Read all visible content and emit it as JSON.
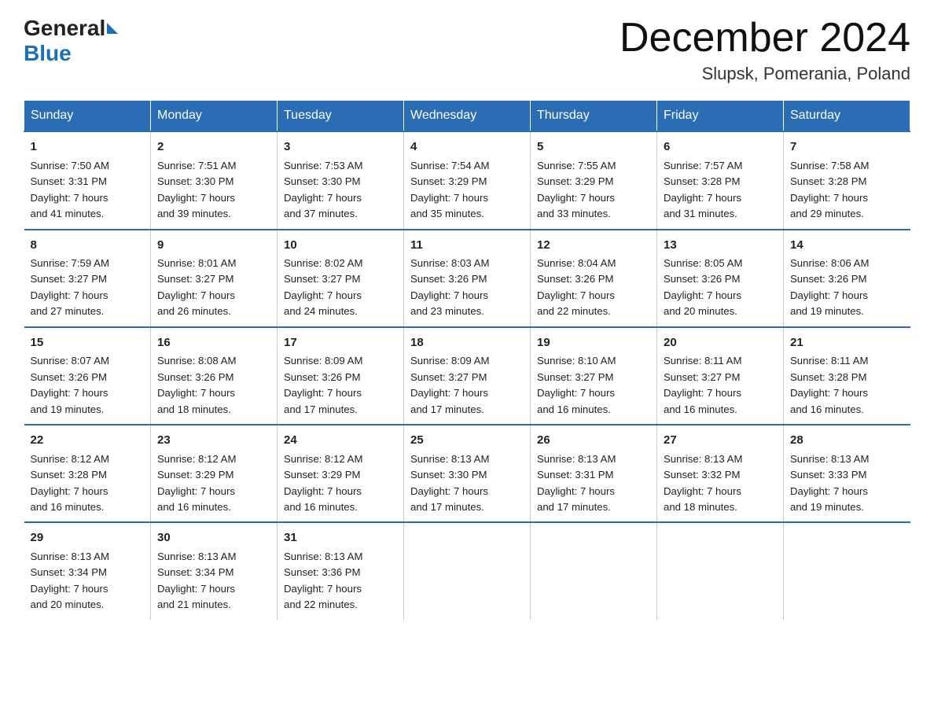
{
  "header": {
    "logo_general": "General",
    "logo_blue": "Blue",
    "month_title": "December 2024",
    "location": "Slupsk, Pomerania, Poland"
  },
  "days_of_week": [
    "Sunday",
    "Monday",
    "Tuesday",
    "Wednesday",
    "Thursday",
    "Friday",
    "Saturday"
  ],
  "weeks": [
    [
      {
        "day": "1",
        "sunrise": "7:50 AM",
        "sunset": "3:31 PM",
        "daylight": "7 hours and 41 minutes."
      },
      {
        "day": "2",
        "sunrise": "7:51 AM",
        "sunset": "3:30 PM",
        "daylight": "7 hours and 39 minutes."
      },
      {
        "day": "3",
        "sunrise": "7:53 AM",
        "sunset": "3:30 PM",
        "daylight": "7 hours and 37 minutes."
      },
      {
        "day": "4",
        "sunrise": "7:54 AM",
        "sunset": "3:29 PM",
        "daylight": "7 hours and 35 minutes."
      },
      {
        "day": "5",
        "sunrise": "7:55 AM",
        "sunset": "3:29 PM",
        "daylight": "7 hours and 33 minutes."
      },
      {
        "day": "6",
        "sunrise": "7:57 AM",
        "sunset": "3:28 PM",
        "daylight": "7 hours and 31 minutes."
      },
      {
        "day": "7",
        "sunrise": "7:58 AM",
        "sunset": "3:28 PM",
        "daylight": "7 hours and 29 minutes."
      }
    ],
    [
      {
        "day": "8",
        "sunrise": "7:59 AM",
        "sunset": "3:27 PM",
        "daylight": "7 hours and 27 minutes."
      },
      {
        "day": "9",
        "sunrise": "8:01 AM",
        "sunset": "3:27 PM",
        "daylight": "7 hours and 26 minutes."
      },
      {
        "day": "10",
        "sunrise": "8:02 AM",
        "sunset": "3:27 PM",
        "daylight": "7 hours and 24 minutes."
      },
      {
        "day": "11",
        "sunrise": "8:03 AM",
        "sunset": "3:26 PM",
        "daylight": "7 hours and 23 minutes."
      },
      {
        "day": "12",
        "sunrise": "8:04 AM",
        "sunset": "3:26 PM",
        "daylight": "7 hours and 22 minutes."
      },
      {
        "day": "13",
        "sunrise": "8:05 AM",
        "sunset": "3:26 PM",
        "daylight": "7 hours and 20 minutes."
      },
      {
        "day": "14",
        "sunrise": "8:06 AM",
        "sunset": "3:26 PM",
        "daylight": "7 hours and 19 minutes."
      }
    ],
    [
      {
        "day": "15",
        "sunrise": "8:07 AM",
        "sunset": "3:26 PM",
        "daylight": "7 hours and 19 minutes."
      },
      {
        "day": "16",
        "sunrise": "8:08 AM",
        "sunset": "3:26 PM",
        "daylight": "7 hours and 18 minutes."
      },
      {
        "day": "17",
        "sunrise": "8:09 AM",
        "sunset": "3:26 PM",
        "daylight": "7 hours and 17 minutes."
      },
      {
        "day": "18",
        "sunrise": "8:09 AM",
        "sunset": "3:27 PM",
        "daylight": "7 hours and 17 minutes."
      },
      {
        "day": "19",
        "sunrise": "8:10 AM",
        "sunset": "3:27 PM",
        "daylight": "7 hours and 16 minutes."
      },
      {
        "day": "20",
        "sunrise": "8:11 AM",
        "sunset": "3:27 PM",
        "daylight": "7 hours and 16 minutes."
      },
      {
        "day": "21",
        "sunrise": "8:11 AM",
        "sunset": "3:28 PM",
        "daylight": "7 hours and 16 minutes."
      }
    ],
    [
      {
        "day": "22",
        "sunrise": "8:12 AM",
        "sunset": "3:28 PM",
        "daylight": "7 hours and 16 minutes."
      },
      {
        "day": "23",
        "sunrise": "8:12 AM",
        "sunset": "3:29 PM",
        "daylight": "7 hours and 16 minutes."
      },
      {
        "day": "24",
        "sunrise": "8:12 AM",
        "sunset": "3:29 PM",
        "daylight": "7 hours and 16 minutes."
      },
      {
        "day": "25",
        "sunrise": "8:13 AM",
        "sunset": "3:30 PM",
        "daylight": "7 hours and 17 minutes."
      },
      {
        "day": "26",
        "sunrise": "8:13 AM",
        "sunset": "3:31 PM",
        "daylight": "7 hours and 17 minutes."
      },
      {
        "day": "27",
        "sunrise": "8:13 AM",
        "sunset": "3:32 PM",
        "daylight": "7 hours and 18 minutes."
      },
      {
        "day": "28",
        "sunrise": "8:13 AM",
        "sunset": "3:33 PM",
        "daylight": "7 hours and 19 minutes."
      }
    ],
    [
      {
        "day": "29",
        "sunrise": "8:13 AM",
        "sunset": "3:34 PM",
        "daylight": "7 hours and 20 minutes."
      },
      {
        "day": "30",
        "sunrise": "8:13 AM",
        "sunset": "3:34 PM",
        "daylight": "7 hours and 21 minutes."
      },
      {
        "day": "31",
        "sunrise": "8:13 AM",
        "sunset": "3:36 PM",
        "daylight": "7 hours and 22 minutes."
      },
      null,
      null,
      null,
      null
    ]
  ],
  "labels": {
    "sunrise": "Sunrise:",
    "sunset": "Sunset:",
    "daylight": "Daylight:"
  }
}
